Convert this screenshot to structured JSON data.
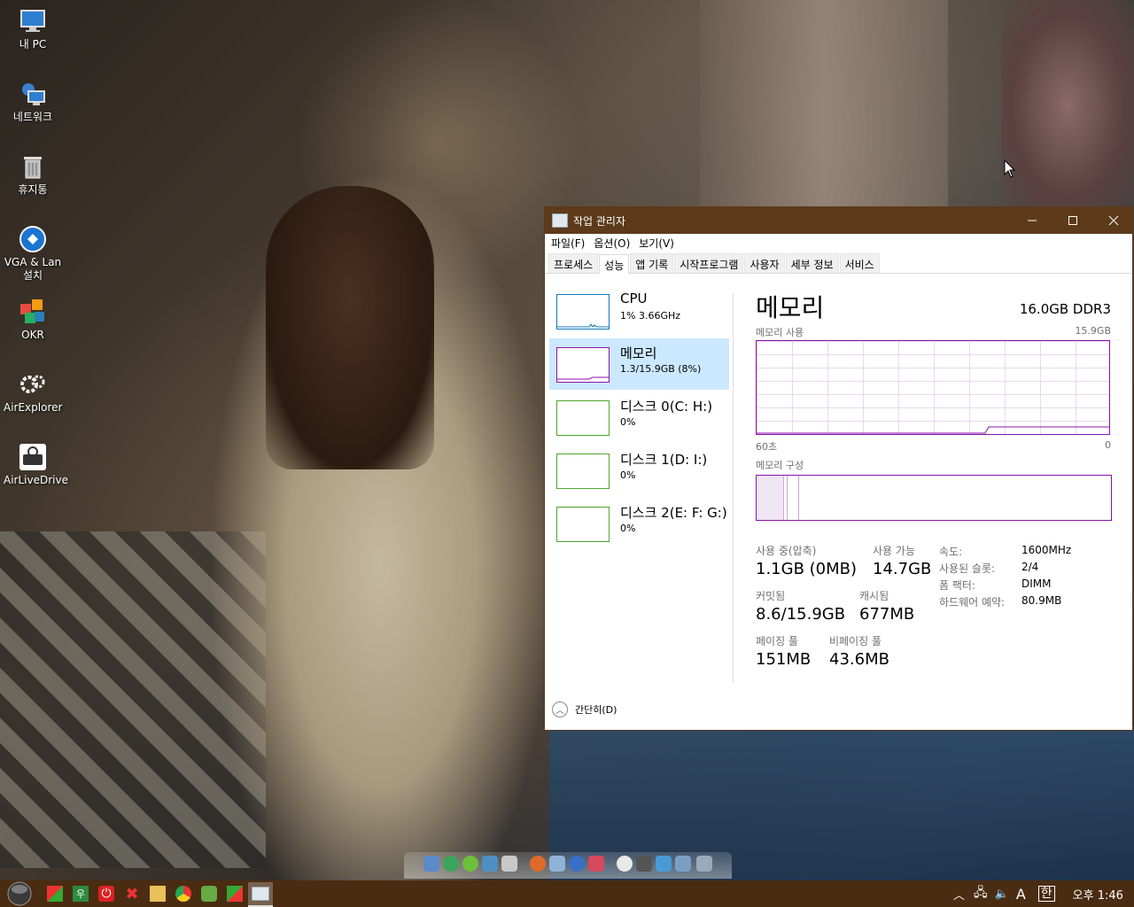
{
  "desktop": {
    "icons": [
      {
        "label": "내 PC",
        "icon": "computer-icon"
      },
      {
        "label": "네트워크",
        "icon": "network-icon"
      },
      {
        "label": "휴지통",
        "icon": "recycle-bin-icon"
      },
      {
        "label": "VGA & Lan 설치",
        "icon": "vga-lan-install-icon"
      },
      {
        "label": "OKR",
        "icon": "okr-icon"
      },
      {
        "label": "AirExplorer",
        "icon": "airexplorer-icon"
      },
      {
        "label": "AirLiveDrive",
        "icon": "airlivedrive-icon"
      }
    ]
  },
  "task_manager": {
    "title": "작업 관리자",
    "menu": [
      "파일(F)",
      "옵션(O)",
      "보기(V)"
    ],
    "tabs": [
      "프로세스",
      "성능",
      "앱 기록",
      "시작프로그램",
      "사용자",
      "세부 정보",
      "서비스"
    ],
    "active_tab": "성능",
    "sidebar": [
      {
        "name": "CPU",
        "value": "1% 3.66GHz"
      },
      {
        "name": "메모리",
        "value": "1.3/15.9GB (8%)"
      },
      {
        "name": "디스크 0(C: H:)",
        "value": "0%"
      },
      {
        "name": "디스크 1(D: I:)",
        "value": "0%"
      },
      {
        "name": "디스크 2(E: F: G:)",
        "value": "0%"
      }
    ],
    "memory": {
      "title": "메모리",
      "spec": "16.0GB DDR3",
      "usage_label": "메모리 사용",
      "usage_max": "15.9GB",
      "time_left": "60초",
      "time_right": "0",
      "composition_label": "메모리 구성",
      "stats": {
        "in_use_label": "사용 중(압축)",
        "in_use_value": "1.1GB (0MB)",
        "available_label": "사용 가능",
        "available_value": "14.7GB",
        "committed_label": "커밋됨",
        "committed_value": "8.6/15.9GB",
        "cached_label": "캐시됨",
        "cached_value": "677MB",
        "paged_label": "페이징 풀",
        "paged_value": "151MB",
        "nonpaged_label": "비페이징 풀",
        "nonpaged_value": "43.6MB"
      },
      "details": [
        {
          "label": "속도:",
          "value": "1600MHz"
        },
        {
          "label": "사용된 슬롯:",
          "value": "2/4"
        },
        {
          "label": "폼 팩터:",
          "value": "DIMM"
        },
        {
          "label": "하드웨어 예약:",
          "value": "80.9MB"
        }
      ]
    },
    "footer": "간단히(D)"
  },
  "taskbar": {
    "ime_letter": "A",
    "ime_lang": "한",
    "clock": "오후 1:46"
  },
  "colors": {
    "accent_memory": "#8b12ae",
    "accent_disk": "#4ea42a",
    "accent_cpu": "#1177bb",
    "titlebar": "#5d3a1a",
    "taskbar": "#4a2c12"
  }
}
